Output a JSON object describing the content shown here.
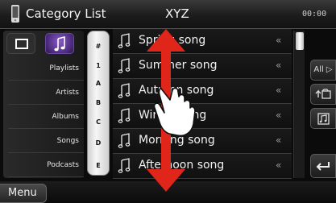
{
  "header": {
    "title": "Category List",
    "source": "XYZ",
    "clock": "00:00",
    "icon": "phone-icon"
  },
  "left_panel": {
    "view_buttons": [
      {
        "name": "list-view",
        "icon": "list-view-icon",
        "active": false
      },
      {
        "name": "music",
        "icon": "music-note-icon",
        "active": true
      }
    ],
    "categories": [
      "Playlists",
      "Artists",
      "Albums",
      "Songs",
      "Podcasts"
    ]
  },
  "index_bar": {
    "letters": [
      "#",
      "1",
      "A",
      "B",
      "C",
      "D",
      "E"
    ]
  },
  "songs": [
    {
      "title": "Spring song"
    },
    {
      "title": "Summer song"
    },
    {
      "title": "Autumn song"
    },
    {
      "title": "Winter song"
    },
    {
      "title": "Morning song"
    },
    {
      "title": "Afternoon song"
    }
  ],
  "song_row_chevron": "«",
  "right_buttons": [
    {
      "label": "All ▷",
      "icon": "all-icon"
    },
    {
      "label": "",
      "icon": "up-folder-icon"
    },
    {
      "label": "",
      "icon": "folder-music-icon"
    }
  ],
  "bottom": {
    "menu_label": "Menu",
    "return_icon": "return-icon"
  },
  "colors": {
    "accent_purple": "#6a3fa8",
    "gesture_red": "#e0261b",
    "index_bg": "#eaeaea"
  },
  "gesture": {
    "arrow_icon": "vertical-scroll-arrow-icon",
    "hand_icon": "pointing-hand-icon"
  }
}
